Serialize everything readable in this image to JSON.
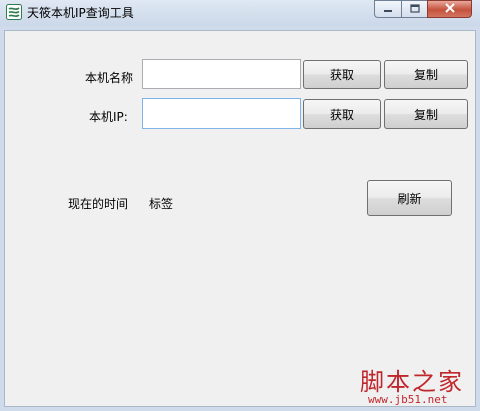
{
  "window": {
    "title": "天筱本机IP查询工具",
    "icon": "app-icon",
    "controls": {
      "minimize_icon": "minimize-icon",
      "maximize_icon": "maximize-icon",
      "close_icon": "close-icon"
    }
  },
  "form": {
    "host_name": {
      "label": "本机名称",
      "value": "",
      "get_label": "获取",
      "copy_label": "复制"
    },
    "local_ip": {
      "label": "本机IP:",
      "value": "",
      "get_label": "获取",
      "copy_label": "复制"
    },
    "time": {
      "label": "现在的时间",
      "value": "标签"
    },
    "refresh_label": "刷新"
  },
  "watermark": {
    "text": "脚本之家",
    "url": "www.jb51.net"
  },
  "colors": {
    "client_bg": "#f0f0f0",
    "frame": "#cfdbea",
    "watermark": "#c0272d",
    "focus_border": "#7eb4ea"
  }
}
